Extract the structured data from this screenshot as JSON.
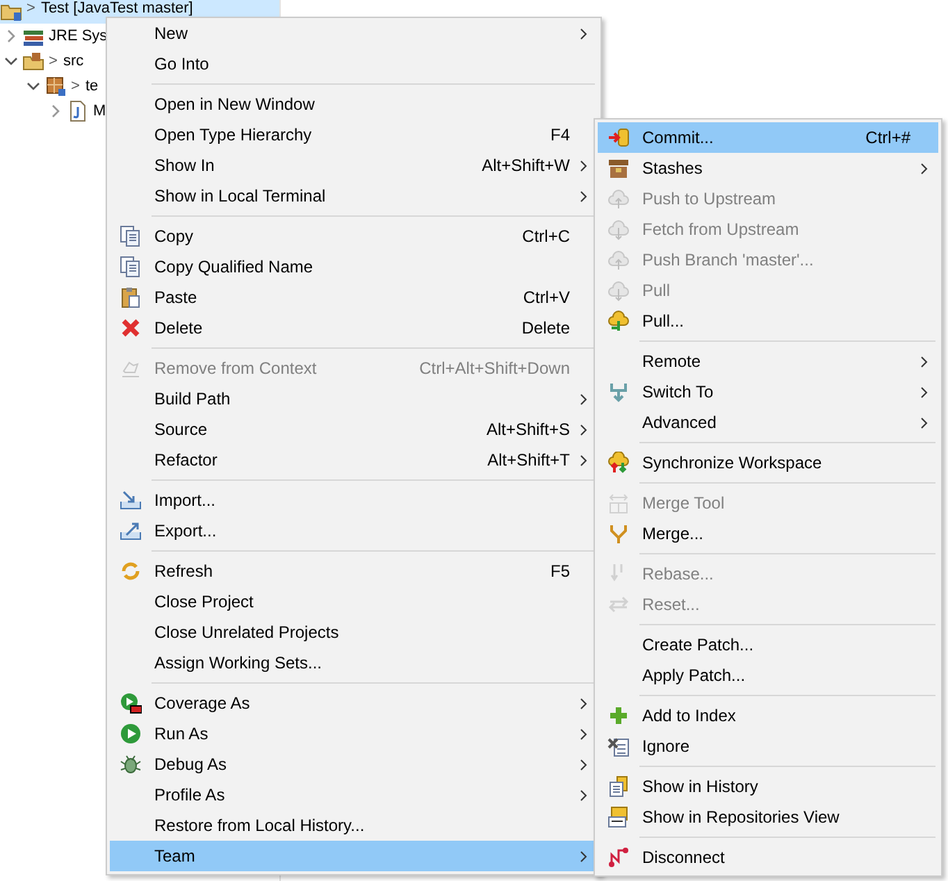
{
  "tree": [
    {
      "label": "Test [JavaTest master]",
      "decoration": ">",
      "kind": "project",
      "selected": true,
      "children": [
        {
          "label": "JRE Sys",
          "kind": "library",
          "expanded": false,
          "selected": false
        },
        {
          "label": "src",
          "decoration": ">",
          "kind": "source-folder",
          "expanded": true,
          "selected": false,
          "children": [
            {
              "label": "te",
              "decoration": ">",
              "kind": "package",
              "expanded": true,
              "selected": false,
              "children": [
                {
                  "label": "M",
                  "kind": "java-file",
                  "expanded": false,
                  "selected": false
                }
              ]
            }
          ]
        }
      ]
    }
  ],
  "context_menu": {
    "groups": [
      {
        "items": [
          {
            "label": "New",
            "submenu": true,
            "disabled": false,
            "selected": false
          },
          {
            "label": "Go Into",
            "submenu": false,
            "disabled": false,
            "selected": false
          }
        ]
      },
      {
        "items": [
          {
            "label": "Open in New Window",
            "submenu": false,
            "disabled": false,
            "selected": false
          },
          {
            "label": "Open Type Hierarchy",
            "shortcut": "F4",
            "submenu": false,
            "disabled": false,
            "selected": false
          },
          {
            "label": "Show In",
            "shortcut": "Alt+Shift+W",
            "submenu": true,
            "disabled": false,
            "selected": false
          },
          {
            "label": "Show in Local Terminal",
            "submenu": true,
            "disabled": false,
            "selected": false
          }
        ]
      },
      {
        "items": [
          {
            "label": "Copy",
            "shortcut": "Ctrl+C",
            "kind": "copy",
            "submenu": false,
            "disabled": false,
            "selected": false
          },
          {
            "label": "Copy Qualified Name",
            "kind": "copy",
            "submenu": false,
            "disabled": false,
            "selected": false
          },
          {
            "label": "Paste",
            "shortcut": "Ctrl+V",
            "kind": "paste",
            "submenu": false,
            "disabled": false,
            "selected": false
          },
          {
            "label": "Delete",
            "shortcut": "Delete",
            "kind": "delete",
            "submenu": false,
            "disabled": false,
            "selected": false
          }
        ]
      },
      {
        "items": [
          {
            "label": "Remove from Context",
            "shortcut": "Ctrl+Alt+Shift+Down",
            "kind": "context",
            "submenu": false,
            "disabled": true,
            "selected": false
          },
          {
            "label": "Build Path",
            "submenu": true,
            "disabled": false,
            "selected": false
          },
          {
            "label": "Source",
            "shortcut": "Alt+Shift+S",
            "submenu": true,
            "disabled": false,
            "selected": false
          },
          {
            "label": "Refactor",
            "shortcut": "Alt+Shift+T",
            "submenu": true,
            "disabled": false,
            "selected": false
          }
        ]
      },
      {
        "items": [
          {
            "label": "Import...",
            "kind": "import",
            "submenu": false,
            "disabled": false,
            "selected": false
          },
          {
            "label": "Export...",
            "kind": "export",
            "submenu": false,
            "disabled": false,
            "selected": false
          }
        ]
      },
      {
        "items": [
          {
            "label": "Refresh",
            "shortcut": "F5",
            "kind": "refresh",
            "submenu": false,
            "disabled": false,
            "selected": false
          },
          {
            "label": "Close Project",
            "submenu": false,
            "disabled": false,
            "selected": false
          },
          {
            "label": "Close Unrelated Projects",
            "submenu": false,
            "disabled": false,
            "selected": false
          },
          {
            "label": "Assign Working Sets...",
            "submenu": false,
            "disabled": false,
            "selected": false
          }
        ]
      },
      {
        "items": [
          {
            "label": "Coverage As",
            "kind": "coverage",
            "submenu": true,
            "disabled": false,
            "selected": false
          },
          {
            "label": "Run As",
            "kind": "run",
            "submenu": true,
            "disabled": false,
            "selected": false
          },
          {
            "label": "Debug As",
            "kind": "debug",
            "submenu": true,
            "disabled": false,
            "selected": false
          },
          {
            "label": "Profile As",
            "submenu": true,
            "disabled": false,
            "selected": false
          },
          {
            "label": "Restore from Local History...",
            "submenu": false,
            "disabled": false,
            "selected": false
          },
          {
            "label": "Team",
            "submenu": true,
            "disabled": false,
            "selected": true
          }
        ]
      }
    ]
  },
  "team_submenu": {
    "groups": [
      {
        "items": [
          {
            "label": "Commit...",
            "shortcut": "Ctrl+#",
            "kind": "commit",
            "submenu": false,
            "disabled": false,
            "selected": true
          },
          {
            "label": "Stashes",
            "kind": "stash",
            "submenu": true,
            "disabled": false,
            "selected": false
          },
          {
            "label": "Push to Upstream",
            "kind": "cloud-up",
            "submenu": false,
            "disabled": true,
            "selected": false
          },
          {
            "label": "Fetch from Upstream",
            "kind": "cloud-down",
            "submenu": false,
            "disabled": true,
            "selected": false
          },
          {
            "label": "Push Branch 'master'...",
            "kind": "cloud-up",
            "submenu": false,
            "disabled": true,
            "selected": false
          },
          {
            "label": "Pull",
            "kind": "cloud-down",
            "submenu": false,
            "disabled": true,
            "selected": false
          },
          {
            "label": "Pull...",
            "kind": "pull",
            "submenu": false,
            "disabled": false,
            "selected": false
          }
        ]
      },
      {
        "items": [
          {
            "label": "Remote",
            "submenu": true,
            "disabled": false,
            "selected": false
          },
          {
            "label": "Switch To",
            "kind": "switch",
            "submenu": true,
            "disabled": false,
            "selected": false
          },
          {
            "label": "Advanced",
            "submenu": true,
            "disabled": false,
            "selected": false
          }
        ]
      },
      {
        "items": [
          {
            "label": "Synchronize Workspace",
            "kind": "sync",
            "submenu": false,
            "disabled": false,
            "selected": false
          }
        ]
      },
      {
        "items": [
          {
            "label": "Merge Tool",
            "kind": "merge-tool",
            "submenu": false,
            "disabled": true,
            "selected": false
          },
          {
            "label": "Merge...",
            "kind": "merge",
            "submenu": false,
            "disabled": false,
            "selected": false
          }
        ]
      },
      {
        "items": [
          {
            "label": "Rebase...",
            "kind": "rebase",
            "submenu": false,
            "disabled": true,
            "selected": false
          },
          {
            "label": "Reset...",
            "kind": "reset",
            "submenu": false,
            "disabled": true,
            "selected": false
          }
        ]
      },
      {
        "items": [
          {
            "label": "Create Patch...",
            "submenu": false,
            "disabled": false,
            "selected": false
          },
          {
            "label": "Apply Patch...",
            "submenu": false,
            "disabled": false,
            "selected": false
          }
        ]
      },
      {
        "items": [
          {
            "label": "Add to Index",
            "kind": "add",
            "submenu": false,
            "disabled": false,
            "selected": false
          },
          {
            "label": "Ignore",
            "kind": "ignore",
            "submenu": false,
            "disabled": false,
            "selected": false
          }
        ]
      },
      {
        "items": [
          {
            "label": "Show in History",
            "kind": "history",
            "submenu": false,
            "disabled": false,
            "selected": false
          },
          {
            "label": "Show in Repositories View",
            "kind": "repo",
            "submenu": false,
            "disabled": false,
            "selected": false
          }
        ]
      },
      {
        "items": [
          {
            "label": "Disconnect",
            "kind": "disconnect",
            "submenu": false,
            "disabled": false,
            "selected": false
          }
        ]
      }
    ]
  }
}
